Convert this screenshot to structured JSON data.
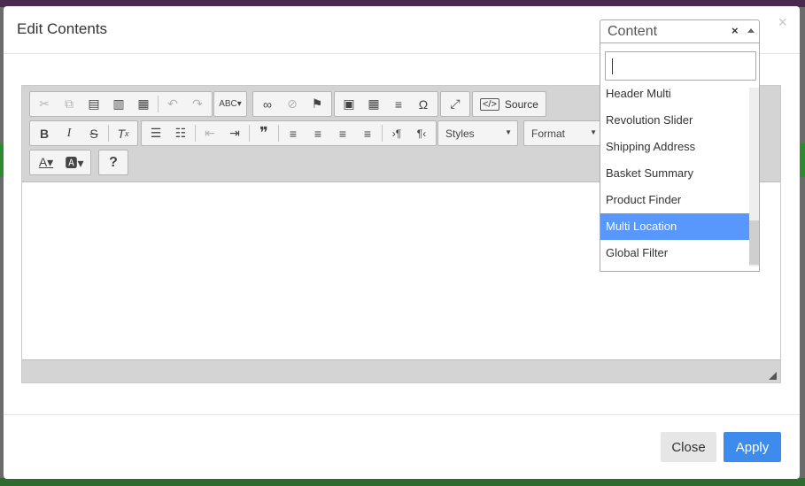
{
  "modal": {
    "title": "Edit Contents",
    "close_x": "×"
  },
  "toolbar": {
    "row1": [
      {
        "icon": "cut-icon",
        "glyph": "✂",
        "enabled": false
      },
      {
        "icon": "copy-icon",
        "glyph": "⧉",
        "enabled": false
      },
      {
        "icon": "paste-icon",
        "glyph": "📋",
        "enabled": true
      },
      {
        "icon": "paste-text-icon",
        "glyph": "📋",
        "enabled": true
      },
      {
        "icon": "paste-word-icon",
        "glyph": "📋",
        "enabled": true
      },
      {
        "icon": "undo-icon",
        "glyph": "↶",
        "enabled": false
      },
      {
        "icon": "redo-icon",
        "glyph": "↷",
        "enabled": false
      },
      {
        "icon": "spellcheck-icon",
        "glyph": "ABC✓",
        "enabled": true
      },
      {
        "icon": "link-icon",
        "glyph": "🔗",
        "enabled": true
      },
      {
        "icon": "unlink-icon",
        "glyph": "⛓",
        "enabled": false
      },
      {
        "icon": "anchor-icon",
        "glyph": "⚑",
        "enabled": true
      },
      {
        "icon": "image-icon",
        "glyph": "▣",
        "enabled": true
      },
      {
        "icon": "table-icon",
        "glyph": "▦",
        "enabled": true
      },
      {
        "icon": "horizontal-line-icon",
        "glyph": "≡",
        "enabled": true
      },
      {
        "icon": "special-char-icon",
        "glyph": "Ω",
        "enabled": true
      },
      {
        "icon": "maximize-icon",
        "glyph": "⤢",
        "enabled": true
      }
    ],
    "source_label": "Source",
    "row2": [
      {
        "icon": "bold-icon",
        "glyph": "B"
      },
      {
        "icon": "italic-icon",
        "glyph": "I"
      },
      {
        "icon": "strike-icon",
        "glyph": "S"
      },
      {
        "icon": "remove-format-icon",
        "glyph": "Tx"
      },
      {
        "icon": "numbered-list-icon",
        "glyph": "☰"
      },
      {
        "icon": "bulleted-list-icon",
        "glyph": "☷"
      },
      {
        "icon": "outdent-icon",
        "glyph": "⇤"
      },
      {
        "icon": "indent-icon",
        "glyph": "⇥"
      },
      {
        "icon": "blockquote-icon",
        "glyph": "❞"
      },
      {
        "icon": "align-left-icon",
        "glyph": "≡"
      },
      {
        "icon": "align-center-icon",
        "glyph": "≡"
      },
      {
        "icon": "align-right-icon",
        "glyph": "≡"
      },
      {
        "icon": "justify-icon",
        "glyph": "≡"
      },
      {
        "icon": "ltr-icon",
        "glyph": "·¶"
      },
      {
        "icon": "rtl-icon",
        "glyph": "¶·"
      }
    ],
    "styles_label": "Styles",
    "format_label": "Format",
    "row3": [
      {
        "icon": "text-color-icon",
        "glyph": "A▾"
      },
      {
        "icon": "bg-color-icon",
        "glyph": "🅰▾"
      },
      {
        "icon": "help-icon",
        "glyph": "?"
      }
    ]
  },
  "select": {
    "value": "Content",
    "clear": "×",
    "options": [
      "Header Multi",
      "Revolution Slider",
      "Shipping Address",
      "Basket Summary",
      "Product Finder",
      "Multi Location",
      "Global Filter"
    ],
    "highlighted": "Multi Location"
  },
  "footer": {
    "close_label": "Close",
    "apply_label": "Apply"
  },
  "colors": {
    "apply_bg": "#3d8ced",
    "highlight_bg": "#5897fb",
    "toolbar_bg": "#d3d4d3"
  }
}
